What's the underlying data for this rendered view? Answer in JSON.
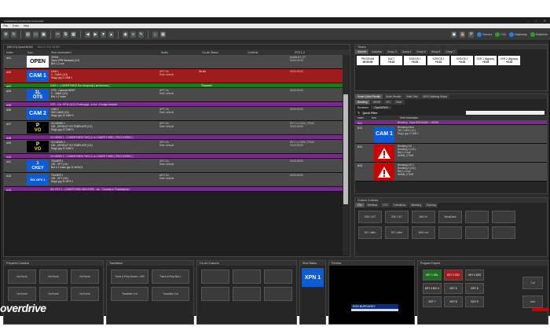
{
  "window": {
    "title": "OVERDRIVE RUNDOWN MANAGER"
  },
  "menu": [
    "File",
    "Tools",
    "Help"
  ],
  "toolbar": {
    "stats": [
      {
        "label": "Server",
        "color": "#2a7de1"
      },
      {
        "label": "CW",
        "color": "#2a9e2a"
      },
      {
        "label": "Gateway",
        "color": "#2a7de1"
      },
      {
        "label": "Switcher",
        "color": "#2a9e2a"
      }
    ]
  },
  "rundown": {
    "tab_label": "[WKCO] OpenNEWS",
    "tab2_label": "WKCO PM NEWS",
    "columns": [
      "Index",
      "Icon",
      "Shot Information",
      "Audio",
      "On-Air Status",
      "Conflicts",
      "RTS 1.2"
    ],
    "rows": [
      {
        "idx": "A01",
        "bg": "bg-gray",
        "tile": "open",
        "tile_text": "OPEN",
        "info": [
          "OPEN",
          "Open XPN Nextcast (1/1)",
          "Brd 1-2 cue"
        ],
        "audio": [
          "",
          ""
        ],
        "onair": "",
        "rts": [
          "NNNN:BT_ST",
          "00:00:20:00"
        ]
      },
      {
        "idx": "A02",
        "bg": "bg-red",
        "tile": "cam",
        "tile_text": "CAM 1",
        "info": [
          "CAM 1",
          "2 - CAM1 (1/1)",
          "Slug1 grp 2 CAM 1"
        ],
        "audio": [
          "APO On",
          "Rate: default"
        ],
        "onair": "On Air",
        "rts": [
          "00:00:00:00"
        ]
      },
      {
        "idx": "A03",
        "bg": "bg-green",
        "short": true,
        "info": [
          "CAM 1 - LOWERTHIRD Ron Burgundy | anchorman |"
        ],
        "onair": "Prepared"
      },
      {
        "idx": "A04",
        "bg": "bg-gray",
        "tile": "ots",
        "tile_top": "1L",
        "tile_text": "OTS",
        "info": [
          "OTS - Camera NEWT",
          "1 - CAM1 (1/1)",
          "Brd 1-2 lower"
        ],
        "audio": [
          "APO On",
          "Rate: default"
        ],
        "onair": "",
        "rts": [
          "00:00:00:00"
        ]
      },
      {
        "idx": "A05",
        "bg": "bg-purple",
        "short": true,
        "info": [
          "OTS - Ca - EF11 (1/1) | Fronts.jpg) - a cut - 4 Image scraped"
        ],
        "onair": ""
      },
      {
        "idx": "A06",
        "bg": "bg-gray",
        "tile": "cam",
        "tile_text": "CAM 2",
        "info": [
          "CAM 2",
          "3S2 CAM2 (1/1)",
          "Slug1 grp 11 CAM 2"
        ],
        "audio": [
          "APO On",
          "Rate: default"
        ],
        "onair": "",
        "rts": [
          "00:00:00:00"
        ]
      },
      {
        "idx": "A07",
        "bg": "bg-gray",
        "tile": "pvo",
        "tile_text": "P",
        "tile_sub": "VO",
        "info": [
          "VO NEWS 1",
          "100 - DEFAULT VO TEMPLATE (1/1)",
          "Slug1 grp 11 CAM 2"
        ],
        "audio": [
          "APO On",
          "Rate: default"
        ],
        "onair": "",
        "rts": [
          "RVT 1.1 0000_VT000",
          "00:00:00:00"
        ]
      },
      {
        "idx": "A08",
        "bg": "bg-purple",
        "short": true,
        "info": [
          "VO NEWS 1 - LOWERTHIRD TWO (1 rs LOWER THIRD ( RECOVERED )"
        ],
        "onair": ""
      },
      {
        "idx": "A09",
        "bg": "bg-gray",
        "tile": "pvo",
        "tile_text": "P",
        "tile_sub": "VO",
        "info": [
          "VO NEWS 2",
          "100 - DEFAULT VO TEMPLATE (1/1)",
          "Slug1 grp 11 CAM 2"
        ],
        "audio": [
          "APO On",
          "Rate: default"
        ],
        "onair": "",
        "rts": [
          "RVT 1.1 0000_VT000",
          "00:00:00:00"
        ]
      },
      {
        "idx": "A10",
        "bg": "bg-purple",
        "short": true,
        "info": [
          "VO NEWS 2 - LOWERTHIRD TWO (1 rs LOWER THIRD ( RECOVERED )"
        ],
        "onair": ""
      },
      {
        "idx": "A11",
        "bg": "bg-gray",
        "tile": "ckey",
        "tile_top": "1",
        "tile_text": "CKEY",
        "info": [
          "TEASER 1",
          "100 - XPT (1/1)",
          "Brd 1-2 lower grp 11 WX1D1"
        ],
        "audio": [
          "APO On",
          "Rate: default"
        ],
        "onair": "",
        "rts": [
          "00:00:00:00"
        ]
      },
      {
        "idx": "A12",
        "bg": "bg-gray",
        "tile": "wx",
        "tile_text": "WX GFX 1",
        "info": [
          "TEASER 1",
          "100 - XPT (1/1)",
          "Slug1 grp 11 GFX 1"
        ],
        "audio": [
          "APO On",
          "Rate: default"
        ],
        "onair": "",
        "rts": [
          "00:00:00:00"
        ]
      },
      {
        "idx": "A13",
        "bg": "bg-purple",
        "short": true,
        "info": [
          "WX GFX 1 - LOWERTHIRD WEATHER - we - Tuesday in Philadelphia |"
        ],
        "onair": ""
      }
    ]
  },
  "timers": {
    "title": "Timers",
    "tabs": [
      "Generic",
      "Inception",
      "Group 3",
      "Group 4",
      "Group 5",
      "Group 6",
      "Group 7"
    ],
    "cells": [
      {
        "name": "PROGRAM",
        "value": "00:00:00"
      },
      {
        "name": "9ACT",
        "value": "+0:23"
      },
      {
        "name": "SOR/CB 1",
        "value": "+0:23"
      },
      {
        "name": "SOR/CB 2",
        "value": "+0:23"
      },
      {
        "name": "SOR/CB 3",
        "value": "+0:23"
      },
      {
        "name": "SVR 1 (Bypass)",
        "value": "+0:23"
      },
      {
        "name": "SVR 2 (Bypass)",
        "value": "+0:23"
      }
    ]
  },
  "quick": {
    "tabs": [
      "Smart Quick Recalls",
      "Quick Recalls",
      "State Test",
      "MOS Gateway Status"
    ],
    "subtabs": [
      "Breaking",
      "WEAR",
      "VIO",
      "Other"
    ],
    "dropdown": "OpenNEWS",
    "filter_label": "Quick Filter",
    "columns": [
      "Index",
      "Icon",
      "Shot Information"
    ],
    "rows": [
      {
        "idx": "B02",
        "short": true,
        "info": [
          "Breaking - https BREAKING - NEWS"
        ]
      },
      {
        "idx": "B03",
        "tile": "cam",
        "tile_text": "CAM 1",
        "info": [
          "Breaking Newt",
          "3S1 CAM1 (1/1)",
          "Slug1 grp 2 CAM 1"
        ]
      },
      {
        "idx": "B04",
        "tile": "warn",
        "info": [
          "Breaking VO",
          "Breaking 1 (1/1)",
          "Brd 1-2 cue",
          "NNNN_VT000"
        ]
      },
      {
        "idx": "B05",
        "tile": "warn",
        "info": [
          "Breaking VO 2",
          "Breaking 2 (1/1)",
          "Brd 1-2 cue",
          "NNNN_VT000"
        ]
      }
    ]
  },
  "custom_controls": {
    "title": "Custom Controls",
    "tabs": [
      "Clin",
      "Weetirna",
      "DTC",
      "Transitions",
      "Weetang",
      "Evening"
    ],
    "buttons": [
      "DSK OUT",
      "DSK OUT",
      "BUG in",
      "NewsDesk",
      "",
      "",
      "DS 1 after",
      "DS 1 after",
      "BUG out",
      "",
      "",
      ""
    ]
  },
  "bottom": {
    "prepared_title": "Prepared Customs",
    "prepared_buttons": [
      "No Event",
      "No Event",
      "No Event",
      "No Event",
      "No Event",
      "No Event"
    ],
    "transitions_title": "Transitions",
    "transitions_buttons": [
      "Trans & Prep Device - MIX",
      "Trans & Prep Brd 1",
      "Transition Cut",
      "Transition Cut"
    ],
    "onair_title": "On-Air Customs",
    "onair_buttons": [
      "",
      "",
      "",
      "",
      "",
      ""
    ],
    "shot_status_title": "Shot Status",
    "shot_status_tile": "XPN 1",
    "preview_title": "Preview",
    "preview_name": "RON BURGUNDY",
    "keyers_title": "Program Keyers",
    "keyers": [
      {
        "label": "KEY 1 DSL",
        "color": "pgm-green"
      },
      {
        "label": "KEY 2 DS2",
        "color": "pgm-red"
      },
      {
        "label": "KEY 3 DS3",
        "color": "pgm-gray"
      },
      {
        "label": "KEY 4 BVI 4",
        "color": "pgm-gray"
      },
      {
        "label": "KEY 5",
        "color": "pgm-gray"
      },
      {
        "label": "KEY 6",
        "color": "pgm-gray"
      },
      {
        "label": "KEY 7",
        "color": "pgm-gray"
      },
      {
        "label": "KEY 8",
        "color": "pgm-gray"
      },
      {
        "label": "KEY 9",
        "color": "pgm-gray"
      }
    ],
    "cut_label": "Cut",
    "auto_label": "Auto"
  },
  "logo_text": "overdrive"
}
